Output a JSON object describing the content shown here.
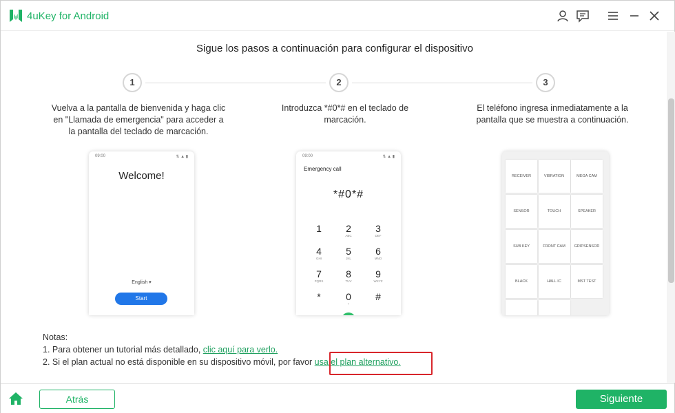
{
  "app": {
    "title": "4uKey for Android",
    "accent": "#1fb366"
  },
  "header_icons": [
    "user-icon",
    "feedback-icon",
    "menu-icon",
    "minimize-icon",
    "close-icon"
  ],
  "main": {
    "title": "Sigue los pasos a continuación para configurar el dispositivo",
    "steps": [
      {
        "number": "1",
        "text": "Vuelva a la pantalla de bienvenida y haga clic en \"Llamada de emergencia\" para acceder a la pantalla del teclado de marcación."
      },
      {
        "number": "2",
        "text": "Introduzca *#0*# en el teclado de marcación."
      },
      {
        "number": "3",
        "text": "El teléfono ingresa inmediatamente a la pantalla que se muestra a continuación."
      }
    ]
  },
  "phone1": {
    "time": "09:00",
    "indicators": "⇅ ▲ ▮",
    "welcome": "Welcome!",
    "language": "English ▾",
    "start": "Start"
  },
  "phone2": {
    "time": "09:00",
    "indicators": "⇅ ▲ ▮",
    "title": "Emergency call",
    "dialed": "*#0*#",
    "keys": [
      {
        "d": "1",
        "l": ""
      },
      {
        "d": "2",
        "l": "ABC"
      },
      {
        "d": "3",
        "l": "DEF"
      },
      {
        "d": "4",
        "l": "GHI"
      },
      {
        "d": "5",
        "l": "JKL"
      },
      {
        "d": "6",
        "l": "MNO"
      },
      {
        "d": "7",
        "l": "PQRS"
      },
      {
        "d": "8",
        "l": "TUV"
      },
      {
        "d": "9",
        "l": "WXYZ"
      },
      {
        "d": "*",
        "l": ""
      },
      {
        "d": "0",
        "l": "+"
      },
      {
        "d": "#",
        "l": ""
      }
    ]
  },
  "phone3": {
    "cells": [
      "RECEIVER",
      "VIBRATION",
      "MEGA CAM",
      "SENSOR",
      "TOUCH",
      "SPEAKER",
      "SUB KEY",
      "FRONT CAM",
      "GRIPSENSOR",
      "BLACK",
      "HALL IC",
      "MST TEST",
      "",
      ""
    ]
  },
  "notes": {
    "heading": "Notas:",
    "line1_text": "1. Para obtener un tutorial más detallado, ",
    "line1_link": "clic aquí para verlo.",
    "line2_text": "2. Si el plan actual no está disponible en su dispositivo móvil, por favor ",
    "line2_link": "usa el plan alternativo."
  },
  "footer": {
    "back": "Atrás",
    "next": "Siguiente"
  }
}
